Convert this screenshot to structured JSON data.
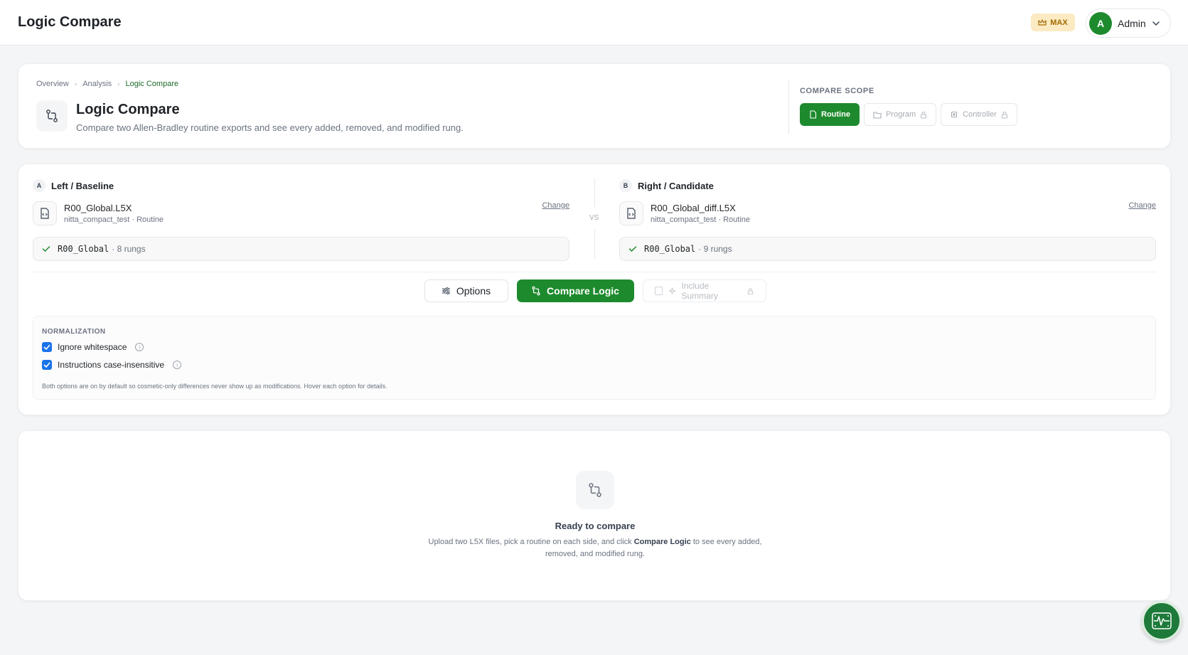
{
  "header": {
    "app_title": "Logic Compare",
    "plan_badge": "MAX",
    "user": {
      "initial": "A",
      "name": "Admin"
    }
  },
  "intro": {
    "breadcrumb": [
      "Overview",
      "Analysis",
      "Logic Compare"
    ],
    "title": "Logic Compare",
    "subtitle": "Compare two Allen-Bradley routine exports and see every added, removed, and modified rung.",
    "scope_label": "COMPARE SCOPE",
    "scope_options": [
      {
        "label": "Routine",
        "active": true,
        "locked": false
      },
      {
        "label": "Program",
        "active": false,
        "locked": true
      },
      {
        "label": "Controller",
        "active": false,
        "locked": true
      }
    ]
  },
  "compare": {
    "left": {
      "letter": "A",
      "title": "Left / Baseline",
      "file_name": "R00_Global.L5X",
      "file_meta": "nitta_compact_test · Routine",
      "change_label": "Change",
      "routine_name": "R00_Global",
      "routine_rungs": "· 8 rungs"
    },
    "vs_label": "VS",
    "right": {
      "letter": "B",
      "title": "Right / Candidate",
      "file_name": "R00_Global_diff.L5X",
      "file_meta": "nitta_compact_test · Routine",
      "change_label": "Change",
      "routine_name": "R00_Global",
      "routine_rungs": "· 9 rungs"
    },
    "actions": {
      "options_label": "Options",
      "compare_label": "Compare Logic",
      "summary_label": "Include Summary"
    },
    "normalization": {
      "label": "NORMALIZATION",
      "options": [
        {
          "label": "Ignore whitespace",
          "checked": true
        },
        {
          "label": "Instructions case-insensitive",
          "checked": true
        }
      ],
      "hint": "Both options are on by default so cosmetic-only differences never show up as modifications. Hover each option for details."
    }
  },
  "empty_state": {
    "title": "Ready to compare",
    "desc_before": "Upload two L5X files, pick a routine on each side, and click ",
    "desc_strong": "Compare Logic",
    "desc_after": " to see every added, removed, and modified rung."
  },
  "colors": {
    "accent": "#1e8a2e",
    "checkbox": "#1a73e8",
    "badge_bg": "#fbeac2",
    "badge_text": "#a26a00"
  }
}
